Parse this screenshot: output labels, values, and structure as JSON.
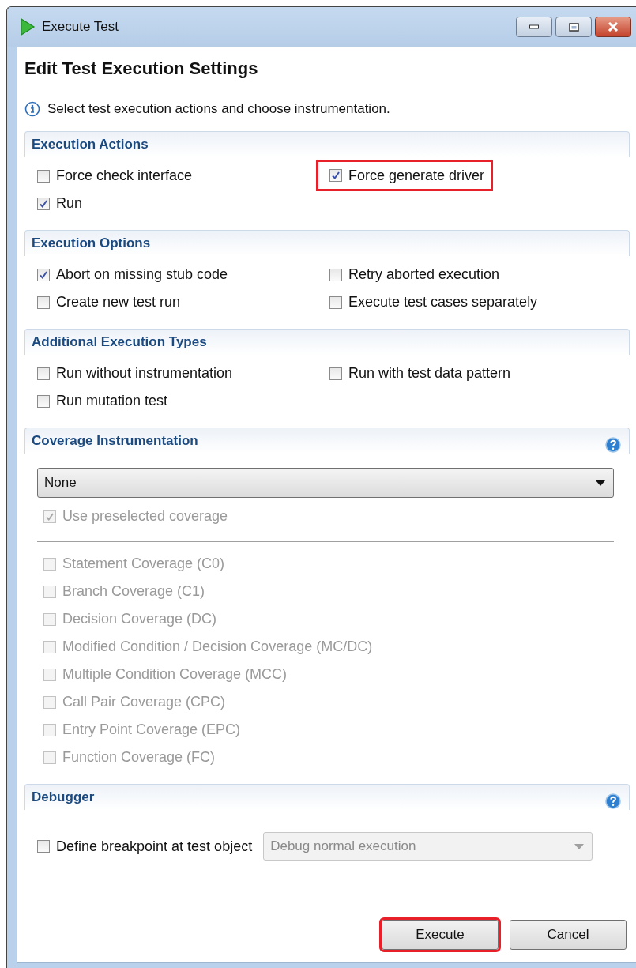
{
  "window": {
    "title": "Execute Test"
  },
  "heading": "Edit Test Execution Settings",
  "info": "Select test execution actions and choose instrumentation.",
  "sections": [
    {
      "kind": "checkgrid",
      "title": "Execution Actions",
      "help": false,
      "options": [
        {
          "label": "Force check interface",
          "checked": false,
          "highlighted": false
        },
        {
          "label": "Force generate driver",
          "checked": true,
          "highlighted": true
        },
        {
          "label": "Run",
          "checked": true,
          "highlighted": false
        }
      ]
    },
    {
      "kind": "checkgrid",
      "title": "Execution Options",
      "help": false,
      "options": [
        {
          "label": "Abort on missing stub code",
          "checked": true,
          "highlighted": false
        },
        {
          "label": "Retry aborted execution",
          "checked": false,
          "highlighted": false
        },
        {
          "label": "Create new test run",
          "checked": false,
          "highlighted": false
        },
        {
          "label": "Execute test cases separately",
          "checked": false,
          "highlighted": false
        }
      ]
    },
    {
      "kind": "checkgrid",
      "title": "Additional Execution Types",
      "help": false,
      "options": [
        {
          "label": "Run without instrumentation",
          "checked": false,
          "highlighted": false
        },
        {
          "label": "Run with test data pattern",
          "checked": false,
          "highlighted": false
        },
        {
          "label": "Run mutation test",
          "checked": false,
          "highlighted": false
        }
      ]
    },
    {
      "kind": "coverage",
      "title": "Coverage Instrumentation",
      "help": true,
      "dropdown": {
        "value": "None"
      },
      "preselected": {
        "label": "Use preselected coverage",
        "checked": true,
        "disabled": true
      },
      "options": [
        {
          "label": "Statement Coverage (C0)",
          "checked": false,
          "disabled": true
        },
        {
          "label": "Branch Coverage (C1)",
          "checked": false,
          "disabled": true
        },
        {
          "label": "Decision Coverage (DC)",
          "checked": false,
          "disabled": true
        },
        {
          "label": "Modified Condition / Decision Coverage (MC/DC)",
          "checked": false,
          "disabled": true
        },
        {
          "label": "Multiple Condition Coverage (MCC)",
          "checked": false,
          "disabled": true
        },
        {
          "label": "Call Pair Coverage (CPC)",
          "checked": false,
          "disabled": true
        },
        {
          "label": "Entry Point Coverage (EPC)",
          "checked": false,
          "disabled": true
        },
        {
          "label": "Function Coverage (FC)",
          "checked": false,
          "disabled": true
        }
      ]
    },
    {
      "kind": "debugger",
      "title": "Debugger",
      "help": true,
      "breakpoint": {
        "label": "Define breakpoint at test object",
        "checked": false
      },
      "dropdown": {
        "value": "Debug normal execution",
        "disabled": true
      }
    }
  ],
  "buttons": [
    {
      "label": "Execute",
      "highlighted": true
    },
    {
      "label": "Cancel",
      "highlighted": false
    }
  ]
}
